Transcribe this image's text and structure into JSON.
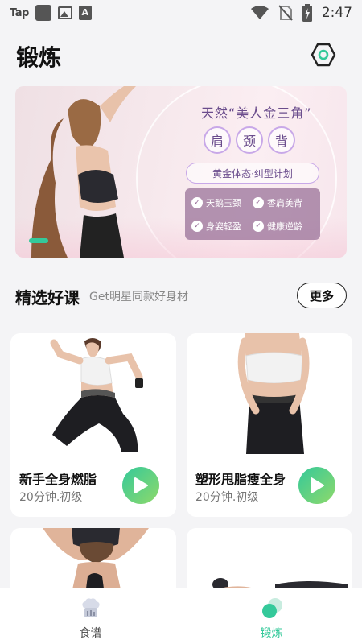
{
  "status_bar": {
    "left_text": "Tap",
    "time": "2:47",
    "icons": [
      "app-square-icon",
      "image-icon",
      "text-a-icon",
      "wifi-icon",
      "no-sim-icon",
      "battery-charging-icon"
    ]
  },
  "header": {
    "title": "锻炼",
    "settings_icon": "hexagon-settings-icon"
  },
  "banner": {
    "headline": "天然“美人金三角”",
    "characters": [
      "肩",
      "颈",
      "背"
    ],
    "plan": "黄金体态·纠型计划",
    "benefits": [
      "天鹅玉颈",
      "香肩美背",
      "身姿轻盈",
      "健康逆龄"
    ]
  },
  "section": {
    "title": "精选好课",
    "subtitle": "Get明星同款好身材",
    "more_label": "更多"
  },
  "courses": [
    {
      "title": "新手全身燃脂",
      "meta": "20分钟.初级"
    },
    {
      "title": "塑形甩脂瘦全身",
      "meta": "20分钟.初级"
    }
  ],
  "bottom_nav": {
    "items": [
      {
        "label": "食谱",
        "icon": "recipe-chef-icon",
        "active": false
      },
      {
        "label": "锻炼",
        "icon": "workout-icon",
        "active": true
      }
    ]
  },
  "colors": {
    "accent": "#34c99a",
    "background": "#f4f4f6",
    "banner_text": "#6a4c8c"
  }
}
